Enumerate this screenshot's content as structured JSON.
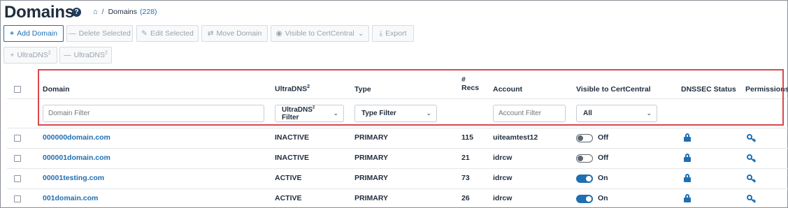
{
  "header": {
    "title": "Domains",
    "help_icon": "question-circle-icon",
    "breadcrumb": {
      "home_icon": "home-icon",
      "separator": "/",
      "current": "Domains",
      "count": "(228)"
    }
  },
  "toolbar": {
    "row1": [
      {
        "name": "add-domain-button",
        "icon": "+",
        "label": "Add Domain",
        "enabled": true
      },
      {
        "name": "delete-selected-button",
        "icon": "—",
        "label": "Delete Selected",
        "enabled": false
      },
      {
        "name": "edit-selected-button",
        "icon": "✎",
        "label": "Edit Selected",
        "enabled": false
      },
      {
        "name": "move-domain-button",
        "icon": "⇄",
        "label": "Move Domain",
        "enabled": false
      },
      {
        "name": "visible-to-certcentral-button",
        "icon": "◉",
        "label": "Visible to CertCentral",
        "chevron": "⌄",
        "enabled": false
      },
      {
        "name": "export-button",
        "icon": "⤓",
        "label": "Export",
        "enabled": false
      }
    ],
    "row2": [
      {
        "name": "add-ultradns-button",
        "icon": "+",
        "label": "UltraDNS",
        "sup": "2",
        "enabled": false
      },
      {
        "name": "remove-ultradns-button",
        "icon": "—",
        "label": "UltraDNS",
        "sup": "2",
        "enabled": false
      }
    ]
  },
  "table": {
    "columns": {
      "domain": "Domain",
      "ultradns": "UltraDNS",
      "ultradns_sup": "2",
      "type": "Type",
      "recs_line1": "#",
      "recs_line2": "Recs",
      "account": "Account",
      "visible": "Visible to CertCentral",
      "dnssec": "DNSSEC Status",
      "permissions": "Permissions"
    },
    "filters": {
      "domain_placeholder": "Domain Filter",
      "ultradns_label": "UltraDNS",
      "ultradns_sup": "2",
      "ultradns_suffix": " Filter",
      "type_label": "Type Filter",
      "account_placeholder": "Account Filter",
      "visible_value": "All",
      "chevron": "⌄"
    },
    "rows": [
      {
        "domain": "000000domain.com",
        "ultradns": "INACTIVE",
        "type": "PRIMARY",
        "recs": "115",
        "account": "uiteamtest12",
        "visible": "Off",
        "on": false
      },
      {
        "domain": "000001domain.com",
        "ultradns": "INACTIVE",
        "type": "PRIMARY",
        "recs": "21",
        "account": "idrcw",
        "visible": "Off",
        "on": false
      },
      {
        "domain": "00001testing.com",
        "ultradns": "ACTIVE",
        "type": "PRIMARY",
        "recs": "73",
        "account": "idrcw",
        "visible": "On",
        "on": true
      },
      {
        "domain": "001domain.com",
        "ultradns": "ACTIVE",
        "type": "PRIMARY",
        "recs": "26",
        "account": "idrcw",
        "visible": "On",
        "on": true
      }
    ]
  },
  "colors": {
    "accent": "#1f6fb2",
    "highlight_border": "#d9474e",
    "text": "#1f2d3d",
    "disabled": "#9aa3ad"
  }
}
